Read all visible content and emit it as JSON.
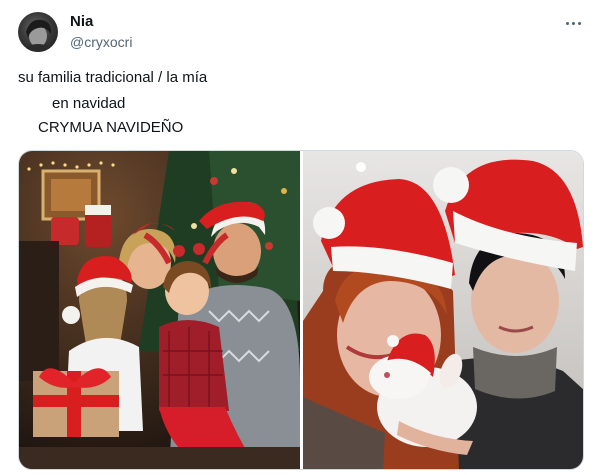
{
  "author": {
    "name": "Nia",
    "handle": "@cryxocri"
  },
  "tweet": {
    "lines": [
      "su familia tradicional / la mía",
      "en navidad",
      "CRYMUA NAVIDEÑO"
    ]
  },
  "media": {
    "photos": [
      {
        "subject": "traditional family with christmas tree and gifts"
      },
      {
        "subject": "couple selfie with santa hat stickers"
      }
    ]
  },
  "icons": {
    "more": "more-horizontal-icon"
  },
  "colors": {
    "text": "#0f1419",
    "secondary": "#536471",
    "border": "#cfd9de",
    "hat_red": "#d81e1e"
  }
}
